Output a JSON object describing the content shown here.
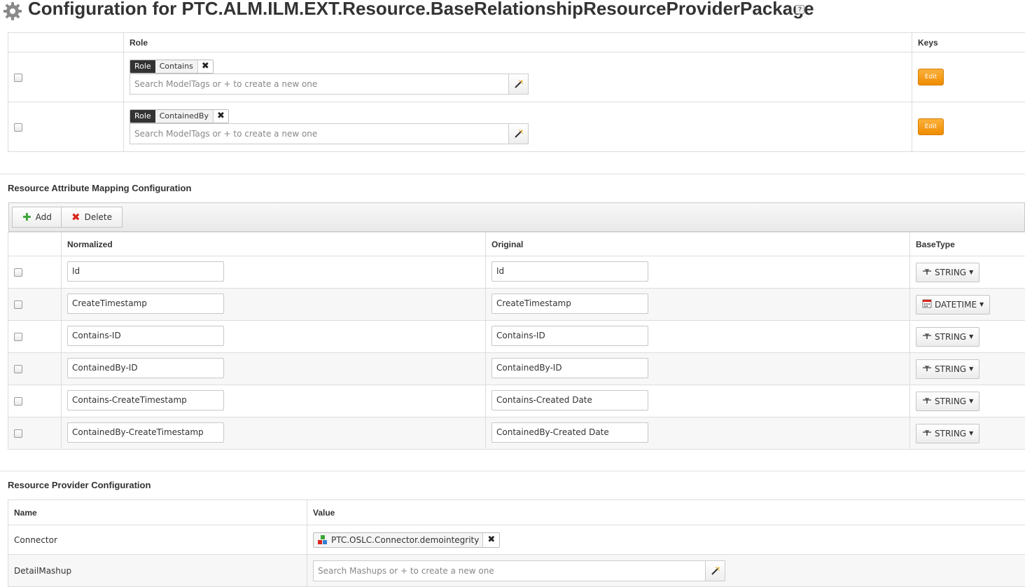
{
  "header": {
    "title": "Configuration for PTC.ALM.ILM.EXT.Resource.BaseRelationshipResourceProviderPackage",
    "help_label": "?",
    "icon": "gear-icon"
  },
  "role_table": {
    "columns": [
      "",
      "Role",
      "Keys"
    ],
    "rows": [
      {
        "tag_type": "Role",
        "tag_value": "Contains",
        "search_placeholder": "Search ModelTags or + to create a new one",
        "edit_label": "Edit"
      },
      {
        "tag_type": "Role",
        "tag_value": "ContainedBy",
        "search_placeholder": "Search ModelTags or + to create a new one",
        "edit_label": "Edit"
      }
    ],
    "remove_glyph": "✖"
  },
  "attr_mapping": {
    "title": "Resource Attribute Mapping Configuration",
    "add_label": "Add",
    "delete_label": "Delete",
    "columns": [
      "",
      "Normalized",
      "Original",
      "BaseType"
    ],
    "rows": [
      {
        "normalized": "Id",
        "original": "Id",
        "basetype": "STRING"
      },
      {
        "normalized": "CreateTimestamp",
        "original": "CreateTimestamp",
        "basetype": "DATETIME"
      },
      {
        "normalized": "Contains-ID",
        "original": "Contains-ID",
        "basetype": "STRING"
      },
      {
        "normalized": "ContainedBy-ID",
        "original": "ContainedBy-ID",
        "basetype": "STRING"
      },
      {
        "normalized": "Contains-CreateTimestamp",
        "original": "Contains-Created Date",
        "basetype": "STRING"
      },
      {
        "normalized": "ContainedBy-CreateTimestamp",
        "original": "ContainedBy-Created Date",
        "basetype": "STRING"
      }
    ]
  },
  "provider_config": {
    "title": "Resource Provider Configuration",
    "columns": [
      "Name",
      "Value"
    ],
    "connector_label": "Connector",
    "connector_value": "PTC.OSLC.Connector.demointegrity",
    "mashup_label": "DetailMashup",
    "mashup_placeholder": "Search Mashups or + to create a new one"
  },
  "colors": {
    "accent_orange": "#f29b17",
    "tag_dark": "#333333",
    "delete_red": "#d9261c",
    "add_green": "#3aa537"
  }
}
